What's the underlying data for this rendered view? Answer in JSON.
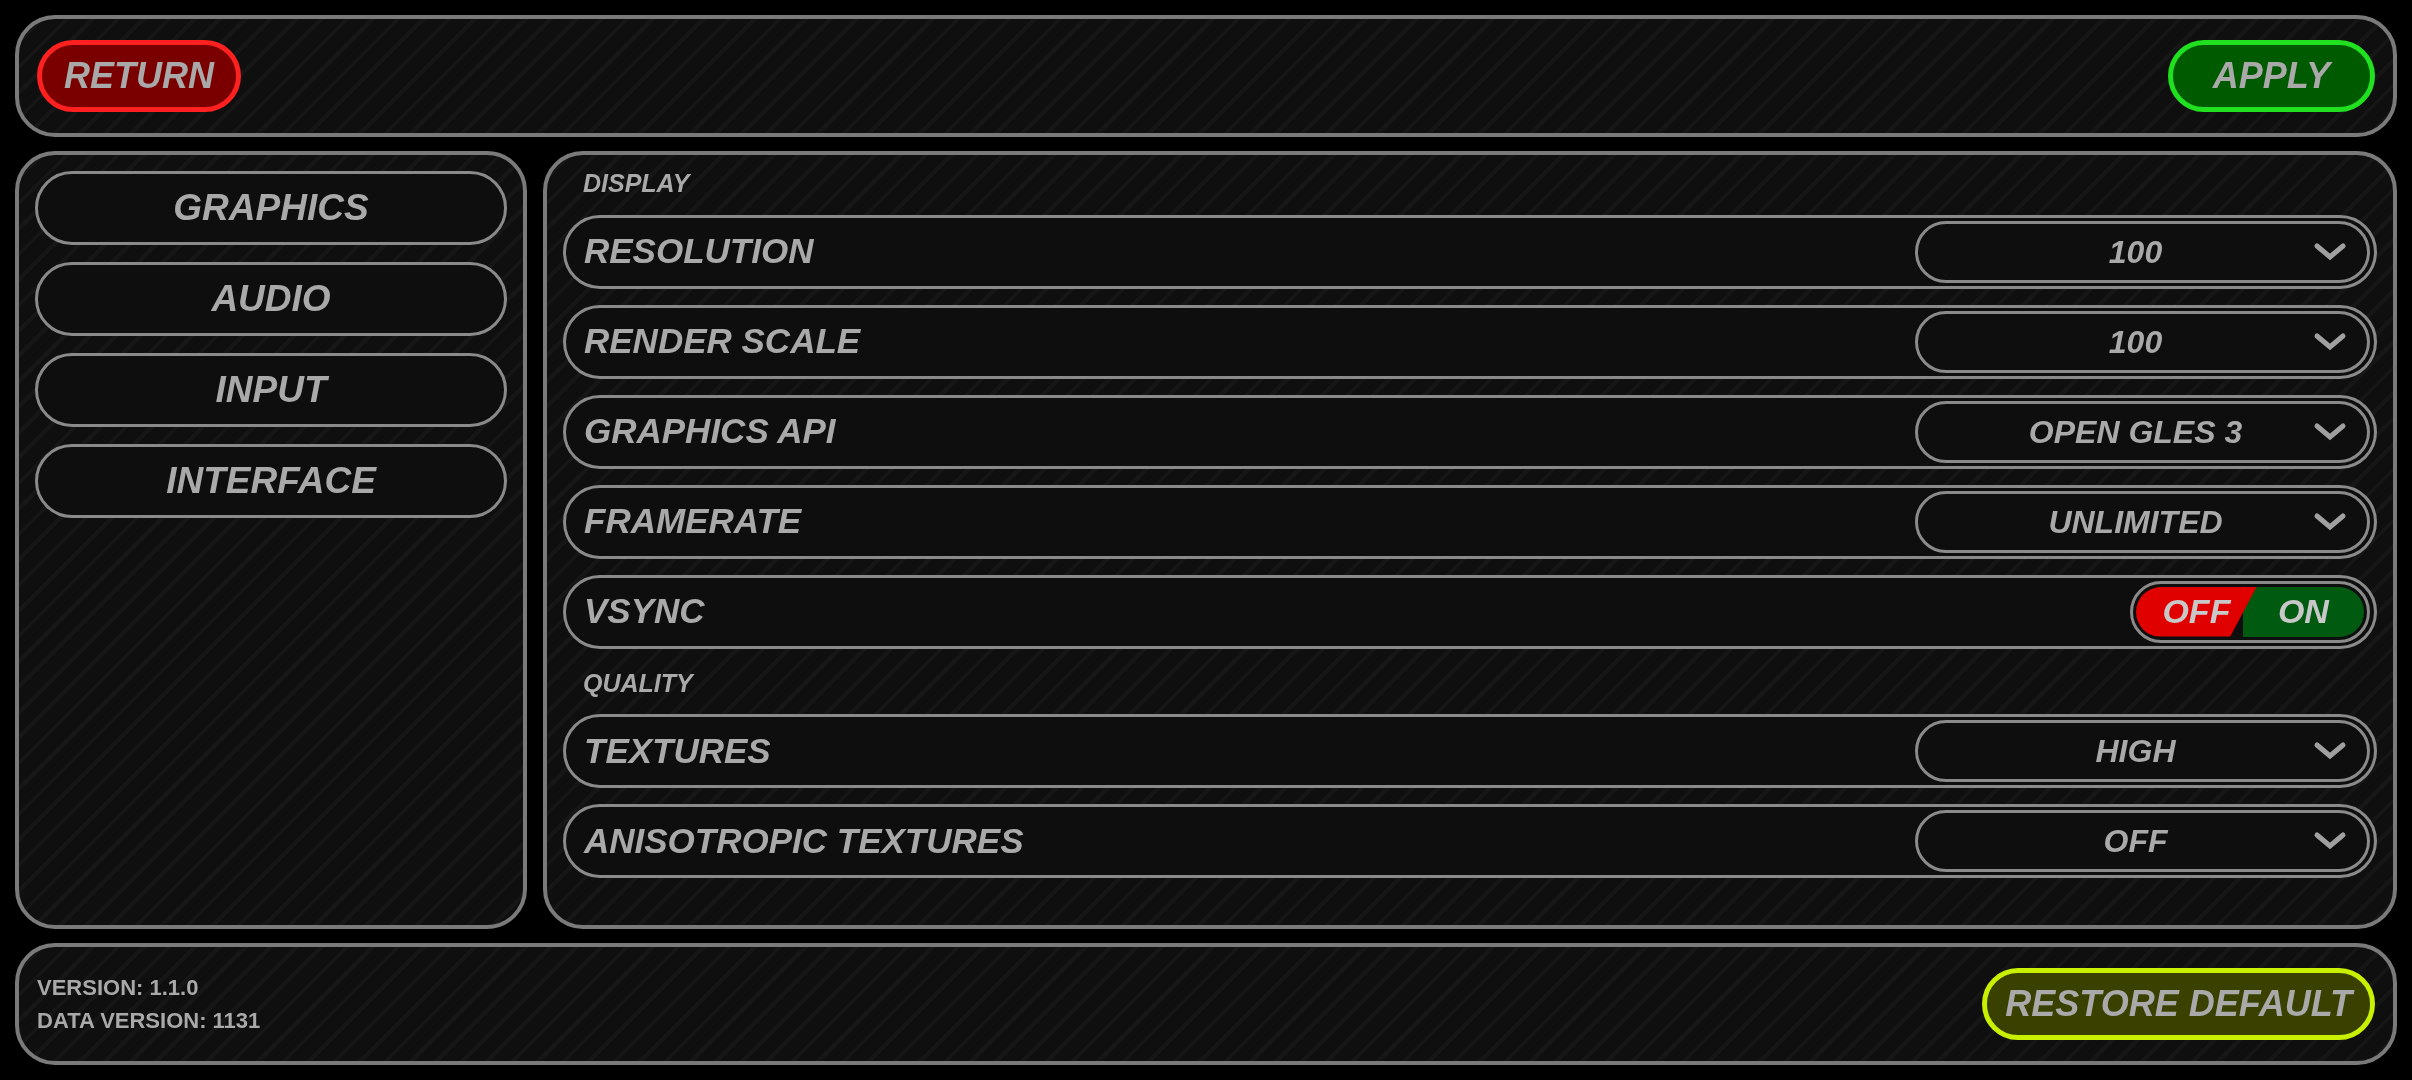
{
  "top_bar": {
    "return_button": "RETURN",
    "apply_button": "APPLY"
  },
  "sidebar": {
    "items": [
      {
        "label": "GRAPHICS"
      },
      {
        "label": "AUDIO"
      },
      {
        "label": "INPUT"
      },
      {
        "label": "INTERFACE"
      }
    ]
  },
  "sections": [
    {
      "title": "DISPLAY",
      "settings": [
        {
          "kind": "dropdown",
          "label": "RESOLUTION",
          "value": "100"
        },
        {
          "kind": "dropdown",
          "label": "RENDER SCALE",
          "value": "100"
        },
        {
          "kind": "dropdown",
          "label": "GRAPHICS API",
          "value": "OPEN GLES 3"
        },
        {
          "kind": "dropdown",
          "label": "FRAMERATE",
          "value": "UNLIMITED"
        },
        {
          "kind": "toggle",
          "label": "VSYNC",
          "off_label": "OFF",
          "on_label": "ON",
          "on": false
        }
      ]
    },
    {
      "title": "QUALITY",
      "settings": [
        {
          "kind": "dropdown",
          "label": "TEXTURES",
          "value": "HIGH"
        },
        {
          "kind": "dropdown",
          "label": "ANISOTROPIC TEXTURES",
          "value": "OFF"
        }
      ]
    }
  ],
  "footer": {
    "version": "VERSION: 1.1.0",
    "data_version": "DATA VERSION: 1131",
    "restore_button": "RESTORE DEFAULT"
  }
}
